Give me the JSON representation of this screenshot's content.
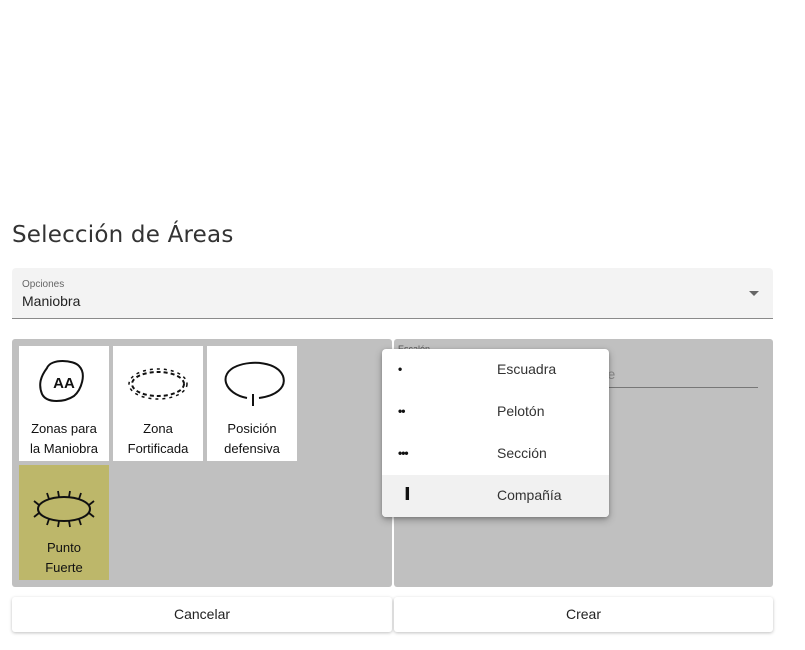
{
  "dialog": {
    "title": "Selección de Áreas",
    "options_label": "Opciones",
    "options_value": "Maniobra"
  },
  "tiles": [
    {
      "label_line1": "Zonas para",
      "label_line2": "la Maniobra",
      "symbol_text": "AA",
      "icon": "maneuver-zone-icon",
      "selected": false
    },
    {
      "label_line1": "Zona",
      "label_line2": "Fortificada",
      "icon": "fortified-zone-icon",
      "selected": false
    },
    {
      "label_line1": "Posición",
      "label_line2": "defensiva",
      "icon": "defensive-position-icon",
      "selected": false
    },
    {
      "label_line1": "Punto",
      "label_line2": "Fuerte",
      "icon": "strong-point-icon",
      "selected": true
    }
  ],
  "echelon_field": {
    "label": "Escalón",
    "placeholder_fragment": "bre"
  },
  "echelon_dropdown": [
    {
      "symbol": "•",
      "label": "Escuadra"
    },
    {
      "symbol": "••",
      "label": "Pelotón"
    },
    {
      "symbol": "•••",
      "label": "Sección"
    },
    {
      "symbol": "I",
      "label": "Compañía"
    }
  ],
  "buttons": {
    "cancel": "Cancelar",
    "create": "Crear"
  },
  "colors": {
    "selected_tile": "#bdb76a",
    "panel_background": "#c0c0c0",
    "field_background": "#f3f3f3"
  }
}
